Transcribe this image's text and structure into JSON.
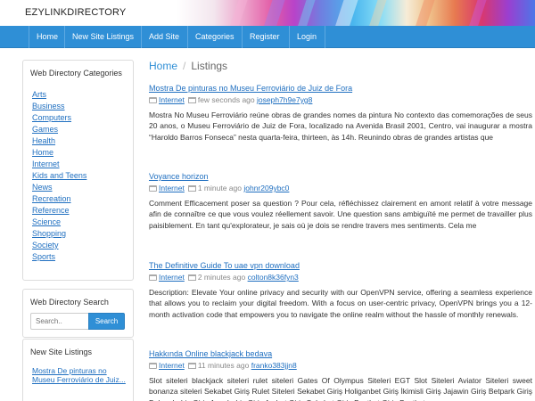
{
  "site": {
    "title": "EZYLINKDIRECTORY"
  },
  "nav": [
    "Home",
    "New Site Listings",
    "Add Site",
    "Categories",
    "Register",
    "Login"
  ],
  "sidebar": {
    "categories_heading": "Web Directory Categories",
    "categories": [
      "Arts",
      "Business",
      "Computers",
      "Games",
      "Health",
      "Home",
      "Internet",
      "Kids and Teens",
      "News",
      "Recreation",
      "Reference",
      "Science",
      "Shopping",
      "Society",
      "Sports"
    ],
    "search_heading": "Web Directory Search",
    "search_placeholder": "Search..",
    "search_button": "Search",
    "new_heading": "New Site Listings",
    "new_items": [
      "Mostra De pinturas no Museu Ferroviário de Juiz..."
    ]
  },
  "breadcrumb": {
    "home": "Home",
    "current": "Listings"
  },
  "listings": [
    {
      "title": "Mostra De pinturas no Museu Ferroviário de Juiz de Fora",
      "category": "Internet",
      "time": "few seconds ago",
      "user": "joseph7h9e7yg8",
      "description": "Mostra No Museu Ferroviário reúne obras de grandes nomes da pintura No contexto das comemorações de seus 20 anos, o Museu Ferroviário de Juiz de Fora, localizado na Avenida Brasil 2001, Centro, vai inaugurar a mostra “Haroldo Barros Fonseca” nesta quarta-feira, thirteen, às 14h. Reunindo obras de grandes artistas que"
    },
    {
      "title": "Voyance horizon",
      "category": "Internet",
      "time": "1 minute ago",
      "user": "johnr209ybc0",
      "description": "Comment Efficacement poser sa question ? Pour cela, réfléchissez clairement en amont relatif à votre message afin de connaître ce que vous voulez réellement savoir. Une question sans ambiguïté me permet de travailler plus paisiblement. En tant qu'explorateur, je sais où je dois se rendre travers mes sentiments. Cela me"
    },
    {
      "title": "The Definitive Guide To uae vpn download",
      "category": "Internet",
      "time": "2 minutes ago",
      "user": "colton8k36fyn3",
      "description": "Description: Elevate Your online privacy and security with our OpenVPN service, offering a seamless experience that allows you to reclaim your digital freedom. With a focus on user-centric privacy, OpenVPN brings you a 12-month activation code that empowers you to navigate the online realm without the hassle of monthly renewals."
    },
    {
      "title": "Hakkında Online blackjack bedava",
      "category": "Internet",
      "time": "11 minutes ago",
      "user": "franko383jjn8",
      "description": "Slot siteleri blackjack siteleri rulet siteleri Gates Of Olympus Siteleri EGT Slot Siteleri Aviator Siteleri sweet bonanza siteleri Sekabet Giriş Rulet Siteleri Sekabet Giriş Holiganbet Giriş İkimisli Giriş Jajawin Giriş Betpark Giriş Bolugabahis Giriş Anyabahis Giriş Arzbet Giriş Sekabet Giriş Bestbet Giriş Bestbet"
    }
  ]
}
